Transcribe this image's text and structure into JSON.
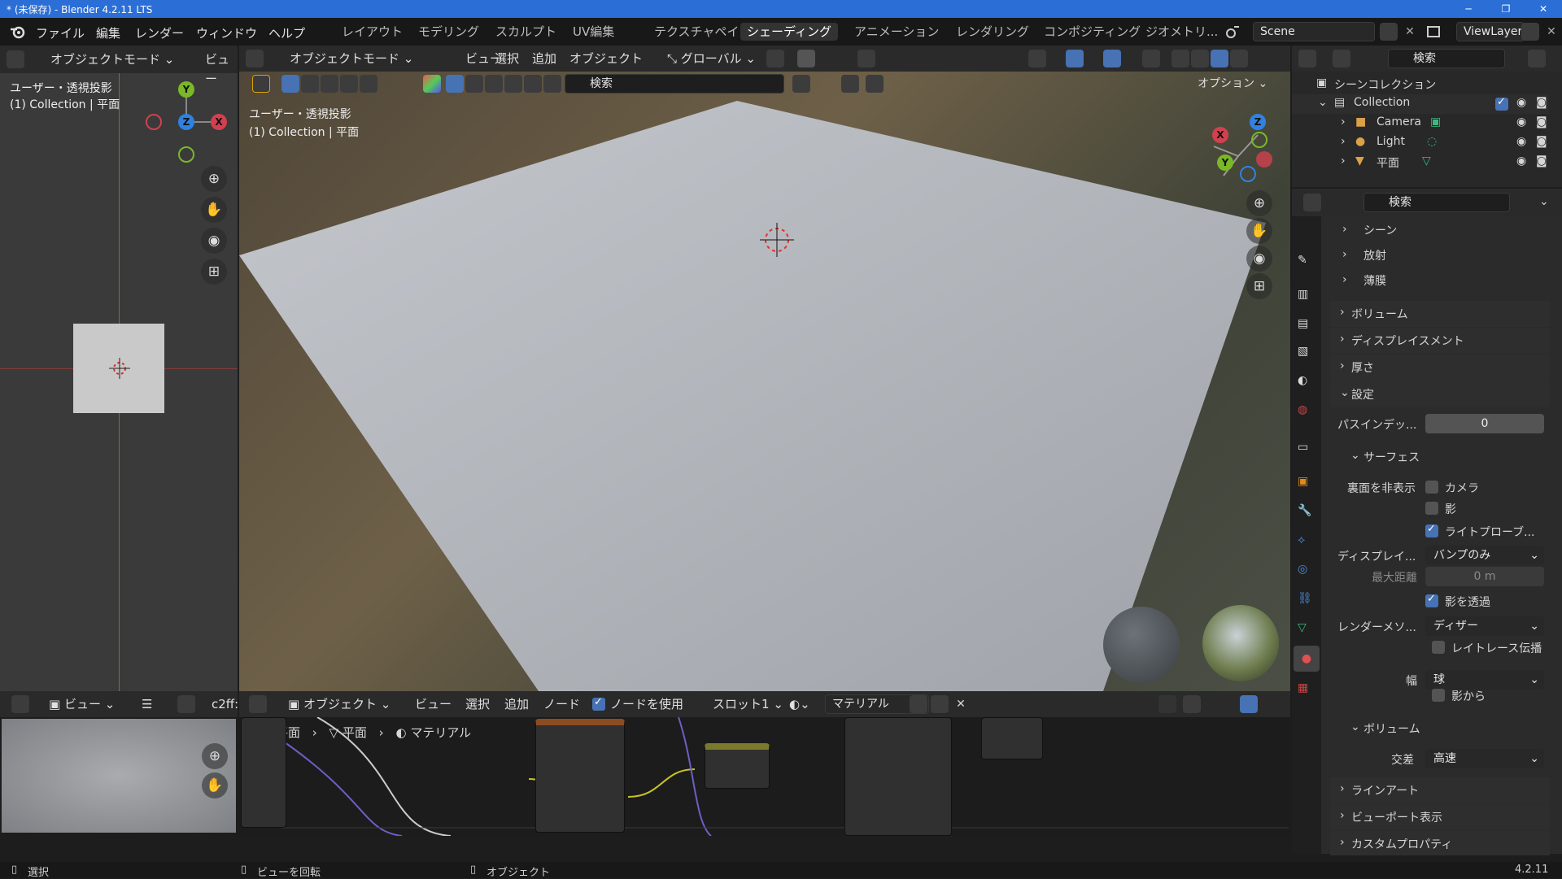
{
  "window": {
    "title": "* (未保存) - Blender 4.2.11 LTS",
    "minimize": "─",
    "maximize": "❐",
    "close": "✕"
  },
  "menu": [
    "ファイル",
    "編集",
    "レンダー",
    "ウィンドウ",
    "ヘルプ"
  ],
  "workspaces": [
    "レイアウト",
    "モデリング",
    "スカルプト",
    "UV編集",
    "テクスチャペイント",
    "シェーディング",
    "アニメーション",
    "レンダリング",
    "コンポジティング",
    "ジオメトリ..."
  ],
  "active_workspace_index": 5,
  "scene": {
    "name": "Scene",
    "view_layer": "ViewLayer"
  },
  "left_viewport": {
    "mode": "オブジェクトモード",
    "view_menu": "ビュー",
    "label_line1": "ユーザー・透視投影",
    "label_line2": "(1) Collection | 平面",
    "axes": {
      "y": "Y",
      "z": "Z",
      "x": "X"
    }
  },
  "main_viewport": {
    "mode": "オブジェクトモード",
    "menus": [
      "ビュー",
      "選択",
      "追加",
      "オブジェクト"
    ],
    "transform_orientation": "グローバル",
    "search_placeholder": "検索",
    "options": "オプション",
    "label_line1": "ユーザー・透視投影",
    "label_line2": "(1) Collection | 平面",
    "axes": {
      "x": "X",
      "y": "Y",
      "z": "Z"
    }
  },
  "image_editor": {
    "view_menu": "ビュー",
    "image_name": "c2ff:"
  },
  "node_editor": {
    "type_menu": "オブジェクト",
    "menus": [
      "ビュー",
      "選択",
      "追加",
      "ノード"
    ],
    "use_nodes_label": "ノードを使用",
    "slot": "スロット1",
    "material": "マテリアル",
    "breadcrumb": [
      "平面",
      "平面",
      "マテリアル"
    ]
  },
  "outliner": {
    "search_placeholder": "検索",
    "scene_collection": "シーンコレクション",
    "items": [
      {
        "name": "Collection",
        "icon": "collection-icon"
      },
      {
        "name": "Camera",
        "icon": "camera-icon"
      },
      {
        "name": "Light",
        "icon": "light-icon"
      },
      {
        "name": "平面",
        "icon": "mesh-icon"
      }
    ]
  },
  "properties": {
    "search_placeholder": "検索",
    "sub_sections": [
      "シーン",
      "放射",
      "薄膜"
    ],
    "sections": [
      "ボリューム",
      "ディスプレイスメント",
      "厚さ",
      "設定"
    ],
    "pass_index_label": "パスインデッ...",
    "pass_index_value": "0",
    "surface_label": "サーフェス",
    "backface_label": "裏面を非表示",
    "checks": {
      "camera": "カメラ",
      "shadow": "影",
      "light_probe": "ライトプローブ...",
      "transparent_shadow": "影を透過",
      "raytrace": "レイトレース伝播",
      "from_shadow": "影から"
    },
    "displacement_label": "ディスプレイ...",
    "displacement_value": "バンプのみ",
    "max_distance_label": "最大距離",
    "max_distance_value": "0 m",
    "render_method_label": "レンダーメソ...",
    "render_method_value": "ディザー",
    "width_label": "幅",
    "width_value": "球",
    "volume_label": "ボリューム",
    "intersection_label": "交差",
    "intersection_value": "高速",
    "bottom_sections": [
      "ラインアート",
      "ビューポート表示",
      "カスタムプロパティ"
    ]
  },
  "statusbar": {
    "select": "選択",
    "rotate": "ビューを回転",
    "object": "オブジェクト",
    "version": "4.2.11"
  },
  "colors": {
    "accent": "#4772b3",
    "axis_x": "#d2404f",
    "axis_y": "#7ab828",
    "axis_z": "#2f82e0"
  }
}
